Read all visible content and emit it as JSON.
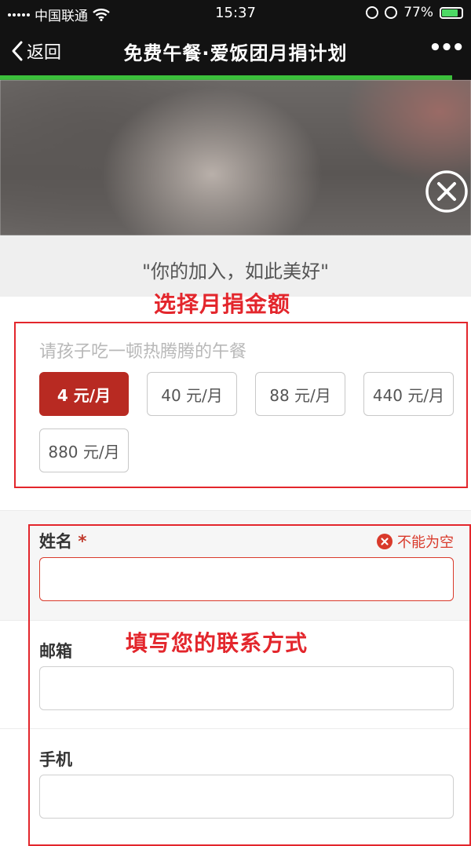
{
  "status_bar": {
    "carrier": "中国联通",
    "time": "15:37",
    "battery": "77%",
    "battery_level": 0.77,
    "icons": [
      "signal-icon",
      "wifi-icon",
      "rotation-lock-icon",
      "alarm-icon",
      "battery-icon"
    ]
  },
  "nav": {
    "back_label": "返回",
    "title": "免费午餐·爱饭团月捐计划",
    "more_label": "•••",
    "page_load_progress": 0.96,
    "colors": {
      "background": "#121212",
      "progress": "#3bbf3b"
    }
  },
  "hero": {
    "close_icon": "close-circle-icon",
    "quote": "\"你的加入，如此美好\""
  },
  "annotations": {
    "amount_title": "选择月捐金额",
    "contact_title": "填写您的联系方式",
    "color": "#e3262c"
  },
  "amount": {
    "prompt": "请孩子吃一顿热腾腾的午餐",
    "options": [
      "4 元/月",
      "40 元/月",
      "88 元/月",
      "440 元/月",
      "880 元/月"
    ],
    "selected_index": 0,
    "selected_color": "#b82a22"
  },
  "form": {
    "name": {
      "label": "姓名",
      "required_mark": "*",
      "error": "不能为空",
      "value": ""
    },
    "email": {
      "label": "邮箱",
      "value": ""
    },
    "phone": {
      "label": "手机",
      "value": ""
    }
  }
}
